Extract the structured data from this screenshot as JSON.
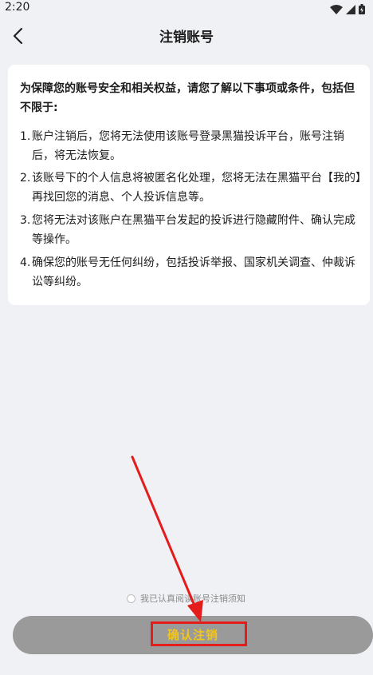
{
  "status_bar": {
    "time": "2:20"
  },
  "header": {
    "title": "注销账号"
  },
  "notice": {
    "intro": "为保障您的账号安全和相关权益，请您了解以下事项或条件，包括但不限于:",
    "items": [
      {
        "num": "1.",
        "text": "账户注销后，您将无法使用该账号登录黑猫投诉平台，账号注销后，将无法恢复。"
      },
      {
        "num": "2.",
        "text": "该账号下的个人信息将被匿名化处理，您将无法在黑猫平台【我的】再找回您的消息、个人投诉信息等。"
      },
      {
        "num": "3.",
        "text": "您将无法对该账户在黑猫平台发起的投诉进行隐藏附件、确认完成等操作。"
      },
      {
        "num": "4.",
        "text": "确保您的账号无任何纠纷，包括投诉举报、国家机关调查、仲裁诉讼等纠纷。"
      }
    ]
  },
  "agreement": {
    "label": "我已认真阅读账号注销须知",
    "checked": false
  },
  "confirm_button": {
    "label": "确认注销"
  },
  "colors": {
    "background": "#f0f1f5",
    "button": "#9a9a9a",
    "button_text": "#f3c41a",
    "annotation": "#e51c1c"
  }
}
